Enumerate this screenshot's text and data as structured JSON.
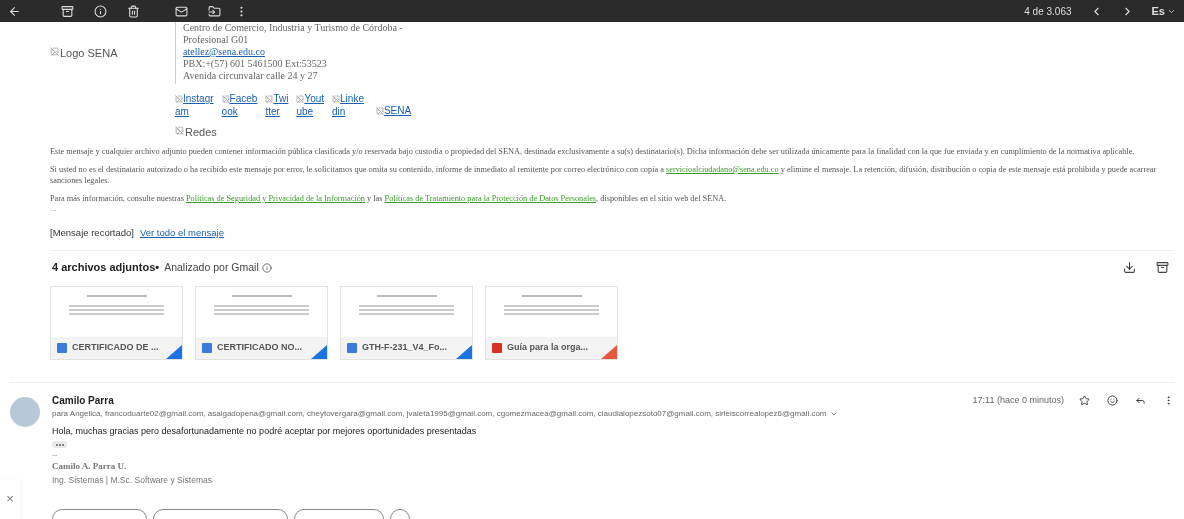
{
  "toolbar": {
    "counter": "4 de 3.063",
    "language": "Es"
  },
  "signature": {
    "logo_alt": "Logo SENA",
    "lines": [
      {
        "kind": "text",
        "text": "Centro de Comercio, Industria y Turismo de Córdoba -"
      },
      {
        "kind": "text",
        "text": "Profesional G01"
      },
      {
        "kind": "link",
        "text": "atellez@sena.edu.co"
      },
      {
        "kind": "text",
        "text": "PBX:+(57) 601 5461500 Ext:53523"
      },
      {
        "kind": "text",
        "text": "Avenida circunvalar calle 24 y 27"
      }
    ],
    "social": [
      {
        "top": "Instagr",
        "bottom": "am"
      },
      {
        "top": "Faceb",
        "bottom": "ook"
      },
      {
        "top": "Twi",
        "bottom": "tter"
      },
      {
        "top": "Yout",
        "bottom": "ube"
      },
      {
        "top": "Linke",
        "bottom": "din"
      }
    ],
    "sena_alt": "SENA",
    "redes_alt": "Redes"
  },
  "disclaimer": [
    {
      "before": "Este mensaje y cualquier archivo adjunto pueden contener información pública clasificada y/o reservada bajo custodia o propiedad del SENA, destinada exclusivamente a su(s) destinatario(s). Dicha información debe ser utilizada únicamente para la finalidad con la que fue enviada y en cumplimiento de la normativa aplicable."
    },
    {
      "before": "Si usted no es el destinatario autorizado o ha recibido este mensaje por error, le solicitamos que omita su contenido, informe de inmediato al remitente por correo electrónico con copia a ",
      "link": "servicioalciudadano@sena.edu.co",
      "middle": " y elimine el mensaje. La retención, difusión, distribución o copia de este mensaje está prohibida y puede acarrear sanciones legales."
    },
    {
      "before": "Para más información, consulte nuestras ",
      "link": "Políticas de Seguridad y Privacidad de la Información",
      "middle": " y las ",
      "link2": "Políticas de Tratamiento para la Protección de Datos Personales",
      "after": ", disponibles en el sitio web del SENA."
    }
  ],
  "ellipsis": "...",
  "trimmed": {
    "label": "[Mensaje recortado]",
    "link": "Ver todo el mensaje"
  },
  "attachments": {
    "title": "4 archivos adjuntos",
    "separator": "•",
    "scanned": "Analizado por Gmail",
    "items": [
      {
        "kind": "word",
        "name": "CERTIFICADO DE ..."
      },
      {
        "kind": "word",
        "name": "CERTIFICADO NO..."
      },
      {
        "kind": "word",
        "name": "GTH-F-231_V4_Fo..."
      },
      {
        "kind": "pdf",
        "name": "Guía para la orga..."
      }
    ]
  },
  "reply": {
    "sender": "Camilo Parra",
    "recipients": "para Angelica, francoduarte02@gmail.com, asalgadopena@gmail.com, cheytovergara@gmail.com, jvaleta1995@gmail.com, cgomezmacea@gmail.com, claudialopezsoto07@gmail.com, sirleiscorrealopez6@gmail.com",
    "time": "17:11 (hace 0 minutos)",
    "body": "Hola, muchas gracias pero desafortunadamente no podré aceptar por mejores oportunidades presentadas",
    "dashes": "--",
    "sig_name": "Camilo A. Parra U.",
    "sig_title": "Ing. Sistemas | M.Sc. Software y Sistemas"
  },
  "close": "×"
}
